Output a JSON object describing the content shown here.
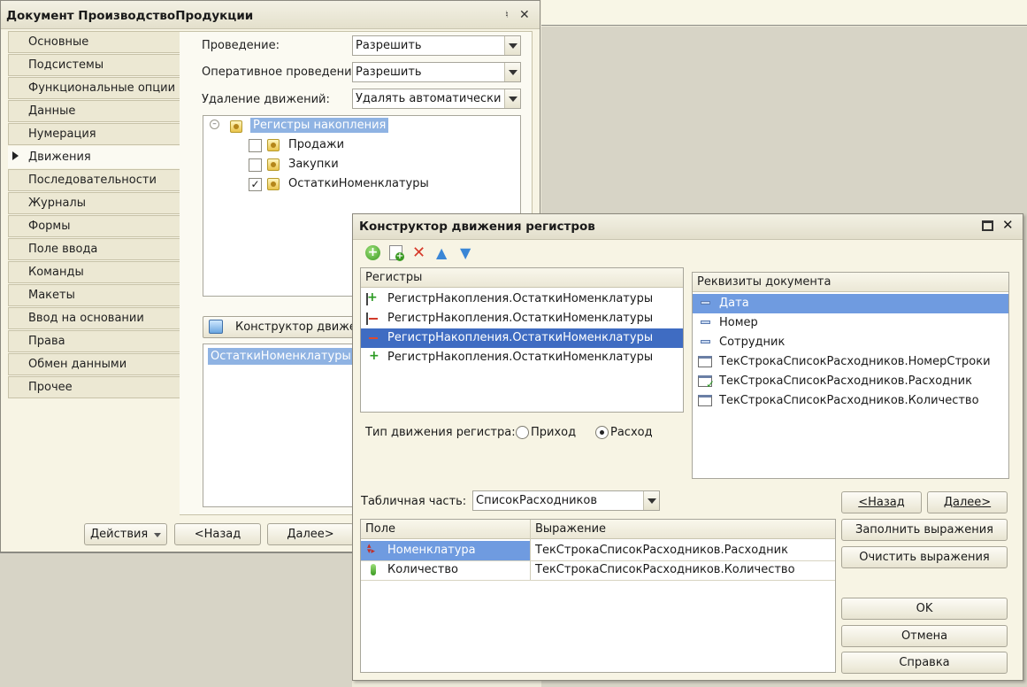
{
  "main_window": {
    "title": "Документ ПроизводствоПродукции",
    "pin_icon": "pin-icon",
    "close_icon": "close-icon",
    "sidebar": [
      "Основные",
      "Подсистемы",
      "Функциональные опции",
      "Данные",
      "Нумерация",
      "Движения",
      "Последовательности",
      "Журналы",
      "Формы",
      "Поле ввода",
      "Команды",
      "Макеты",
      "Ввод на основании",
      "Права",
      "Обмен данными",
      "Прочее"
    ],
    "active_item": "Движения",
    "fields": {
      "posting_label": "Проведение:",
      "posting_value": "Разрешить",
      "realtime_label": "Оперативное проведени",
      "realtime_value": "Разрешить",
      "delete_label": "Удаление движений:",
      "delete_value": "Удалять автоматически п"
    },
    "tree": {
      "root": "Регистры накопления",
      "items": [
        {
          "label": "Продажи",
          "checked": false
        },
        {
          "label": "Закупки",
          "checked": false
        },
        {
          "label": "ОстаткиНоменклатуры",
          "checked": true
        }
      ]
    },
    "constructor_button": "Конструктор движен",
    "movements_list": [
      "ОстаткиНоменклатуры"
    ],
    "footer": {
      "actions": "Действия",
      "back": "<Назад",
      "next": "Далее>"
    }
  },
  "dialog": {
    "title": "Конструктор движения регистров",
    "toolbar_icons": [
      "add-icon",
      "add-copy-icon",
      "delete-icon",
      "move-up-icon",
      "move-down-icon"
    ],
    "registers_header": "Регистры",
    "registers": [
      {
        "label": "РегистрНакопления.ОстаткиНоменклатуры",
        "icon": "plus-minus"
      },
      {
        "label": "РегистрНакопления.ОстаткиНоменклатуры",
        "icon": "minus"
      },
      {
        "label": "РегистрНакопления.ОстаткиНоменклатуры",
        "icon": "minus"
      },
      {
        "label": "РегистрНакопления.ОстаткиНоменклатуры",
        "icon": "plus"
      }
    ],
    "selected_register_index": 2,
    "movement_type_label": "Тип движения регистра:",
    "radio_in": "Приход",
    "radio_out": "Расход",
    "movement_type_selected": "Расход",
    "attrs_header": "Реквизиты документа",
    "attributes": [
      "Дата",
      "Номер",
      "Сотрудник",
      "ТекСтрокаСписокРасходников.НомерСтроки",
      "ТекСтрокаСписокРасходников.Расходник",
      "ТекСтрокаСписокРасходников.Количество"
    ],
    "selected_attribute_index": 0,
    "tabular_label": "Табличная часть:",
    "tabular_value": "СписокРасходников",
    "table": {
      "col_field": "Поле",
      "col_expr": "Выражение",
      "rows": [
        {
          "field": "Номенклатура",
          "expr": "ТекСтрокаСписокРасходников.Расходник"
        },
        {
          "field": "Количество",
          "expr": "ТекСтрокаСписокРасходников.Количество"
        }
      ]
    },
    "buttons": {
      "back": "<Назад",
      "next": "Далее>",
      "fill": "Заполнить выражения",
      "clear": "Очистить выражения",
      "ok": "OK",
      "cancel": "Отмена",
      "help": "Справка"
    }
  }
}
